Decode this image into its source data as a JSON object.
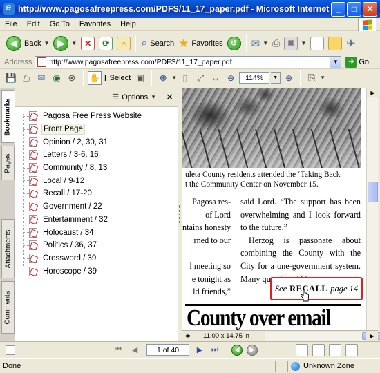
{
  "window": {
    "title": "http://www.pagosafreepress.com/PDFS/11_17_paper.pdf - Microsoft Internet Explorer"
  },
  "menu": {
    "items": [
      "File",
      "Edit",
      "Go To",
      "Favorites",
      "Help"
    ]
  },
  "ie_toolbar": {
    "back_label": "Back",
    "search_label": "Search",
    "favorites_label": "Favorites"
  },
  "address": {
    "label": "Address",
    "url": "http://www.pagosafreepress.com/PDFS/11_17_paper.pdf",
    "go_label": "Go"
  },
  "reader_toolbar": {
    "select_label": "Select",
    "zoom": "114%"
  },
  "side_tabs": [
    "Bookmarks",
    "Pages",
    "Attachments",
    "Comments"
  ],
  "bookmarks": {
    "options_label": "Options",
    "items": [
      "Pagosa Free Press Website",
      "Front Page",
      "Opinion / 2, 30, 31",
      "Letters / 3-6, 16",
      "Community / 8, 13",
      "Local / 9-12",
      "Recall / 17-20",
      "Government / 22",
      "Entertainment / 32",
      "Holocaust / 34",
      "Politics / 36, 37",
      "Crossword / 39",
      "Horoscope / 39"
    ],
    "selected_index": 1
  },
  "document": {
    "caption_line1": "uleta County residents attended the ‘Taking Back",
    "caption_line2": "t the Community Center on November 15.",
    "col1_lines": [
      "Pagosa res-",
      "of Lord",
      "ntains honesty",
      "rned to our",
      "",
      "l meeting so",
      "e tonight as",
      "ld friends,”"
    ],
    "col2_para1": "said Lord. “The support has been overwhelming and I look forward to the future.”",
    "col2_para2": "Herzog is passonate about combining the County with the City for a one-government system. Many questioned his",
    "see_prefix": "See",
    "see_link": "RECALL",
    "see_suffix": "page 14",
    "headline": "County over email",
    "page_size": "11.00 x 14.75 in"
  },
  "navigation": {
    "page_indicator": "1 of 40"
  },
  "status": {
    "text": "Done",
    "zone": "Unknown Zone"
  },
  "colors": {
    "titlebar": "#0842c4",
    "highlight_box": "#e02020"
  }
}
